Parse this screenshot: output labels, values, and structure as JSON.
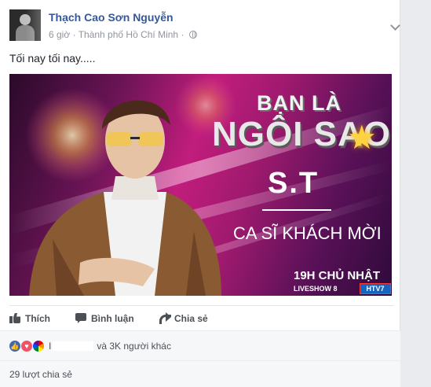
{
  "post": {
    "author": "Thạch Cao Sơn Nguyễn",
    "time": "6 giờ",
    "separator": "·",
    "location": "Thành phố Hồ Chí Minh",
    "location_separator": "·",
    "text": "Tối nay tối nay....."
  },
  "image": {
    "line1": "BẠN LÀ",
    "line2": "NGÔI SAO",
    "star": "★",
    "artist": "S.T",
    "role": "CA SĨ KHÁCH MỜI",
    "time": "19H CHỦ NHẬT",
    "liveshow": "LIVESHOW 8",
    "channel": "HTV7"
  },
  "actions": {
    "like": "Thích",
    "comment": "Bình luận",
    "share": "Chia sẻ"
  },
  "reactions": {
    "text": "và 3K người khác",
    "prefix": "I"
  },
  "shares": {
    "text": "29 lượt chia sẻ"
  },
  "colors": {
    "link": "#365899",
    "meta": "#90949c",
    "like_blue": "#4267b2",
    "love_red": "#f25268"
  }
}
